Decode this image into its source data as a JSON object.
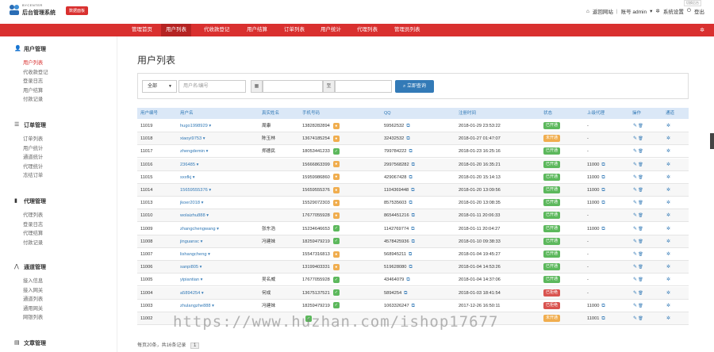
{
  "brand": {
    "small": "BYCENTER",
    "name": "后台管理系统",
    "badge": "数据面板"
  },
  "topbar": {
    "tip": "切换后台",
    "home": "返回网站",
    "account": "账号 admin",
    "settings": "系统设置",
    "logout": "登出"
  },
  "nav": [
    "管理首页",
    "用户列表",
    "代收款登记",
    "用户结算",
    "订单列表",
    "用户统计",
    "代理列表",
    "管理员列表"
  ],
  "sidebar": [
    {
      "title": "用户管理",
      "icon": "user-icon",
      "items": [
        "用户列表",
        "代收款登记",
        "登录日志",
        "用户结算",
        "付款记录"
      ]
    },
    {
      "title": "订单管理",
      "icon": "list-icon",
      "items": [
        "订单列表",
        "用户统计",
        "通道统计",
        "代理统计",
        "冻结订单"
      ]
    },
    {
      "title": "代理管理",
      "icon": "book-icon",
      "items": [
        "代理列表",
        "登录日志",
        "代理结算",
        "付款记录"
      ]
    },
    {
      "title": "通道管理",
      "icon": "road-icon",
      "items": [
        "接入信息",
        "接入网关",
        "通道列表",
        "通用网关",
        "网银列表"
      ]
    },
    {
      "title": "文章管理",
      "icon": "doc-icon",
      "items": []
    }
  ],
  "main": {
    "title": "用户列表",
    "filter": {
      "select_value": "全部",
      "keyword_placeholder": "用户名/编号",
      "date_icon": "▦",
      "date_sep": "至",
      "query_label": "立即查询"
    },
    "columns": [
      "用户编号",
      "用户名",
      "真实姓名",
      "手机号码",
      "QQ",
      "注册时间",
      "状态",
      "上级代理",
      "操作",
      "通道"
    ],
    "rows": [
      {
        "id": "11019",
        "name": "hugo1998929",
        "real": "周康",
        "phone": "13828282894",
        "pi": "orange",
        "qq": "59562532",
        "time": "2018-01-29 23:53:22",
        "status": "已开通",
        "sc": "green",
        "agent": "-"
      },
      {
        "id": "11018",
        "name": "xiaoyi9753",
        "real": "陈玉林",
        "phone": "13674185254",
        "pi": "orange",
        "qq": "32432532",
        "time": "2018-01-27 01:47:07",
        "status": "未开通",
        "sc": "orange",
        "agent": "-"
      },
      {
        "id": "11017",
        "name": "zhengdemin",
        "real": "郑德民",
        "phone": "18053441233",
        "pi": "green",
        "qq": "799784222",
        "time": "2018-01-23 16:25:16",
        "status": "已开通",
        "sc": "green",
        "agent": "-"
      },
      {
        "id": "11016",
        "name": "236485",
        "real": "",
        "phone": "15666863399",
        "pi": "orange",
        "qq": "2997568282",
        "time": "2018-01-20 16:35:21",
        "status": "已开通",
        "sc": "green",
        "agent": "11000"
      },
      {
        "id": "11015",
        "name": "sxxfkj",
        "real": "",
        "phone": "15959986860",
        "pi": "orange",
        "qq": "429067428",
        "time": "2018-01-20 15:14:13",
        "status": "已开通",
        "sc": "green",
        "agent": "11000"
      },
      {
        "id": "11014",
        "name": "15659555376",
        "real": "",
        "phone": "15659555376",
        "pi": "orange",
        "qq": "1104369448",
        "time": "2018-01-20 13:09:56",
        "status": "已开通",
        "sc": "green",
        "agent": "11000"
      },
      {
        "id": "11013",
        "name": "jkoer2018",
        "real": "",
        "phone": "15529072303",
        "pi": "orange",
        "qq": "857535603",
        "time": "2018-01-20 13:08:35",
        "status": "已开通",
        "sc": "green",
        "agent": "11000"
      },
      {
        "id": "11010",
        "name": "wolaizhu888",
        "real": "",
        "phone": "17677055928",
        "pi": "orange",
        "qq": "8654451216",
        "time": "2018-01-11 20:06:33",
        "status": "已开通",
        "sc": "green",
        "agent": "-"
      },
      {
        "id": "11009",
        "name": "zhangchengwang",
        "real": "张东浩",
        "phone": "15234646653",
        "pi": "green",
        "qq": "1142769774",
        "time": "2018-01-11 20:04:27",
        "status": "已开通",
        "sc": "green",
        "agent": "11000"
      },
      {
        "id": "11008",
        "name": "jinguansc",
        "real": "冯建妹",
        "phone": "18259479219",
        "pi": "green",
        "qq": "4578425936",
        "time": "2018-01-10 09:38:33",
        "status": "已开通",
        "sc": "green",
        "agent": "-"
      },
      {
        "id": "11007",
        "name": "lishangcheng",
        "real": "",
        "phone": "15547316813",
        "pi": "orange",
        "qq": "568945211",
        "time": "2018-01-04 19:45:27",
        "status": "已开通",
        "sc": "green",
        "agent": "-"
      },
      {
        "id": "11006",
        "name": "sanpi805",
        "real": "",
        "phone": "13199403331",
        "pi": "orange",
        "qq": "519628080",
        "time": "2018-01-04 14:53:26",
        "status": "已开通",
        "sc": "green",
        "agent": "-"
      },
      {
        "id": "11005",
        "name": "yipiantian",
        "real": "吴名威",
        "phone": "17677055928",
        "pi": "green",
        "qq": "43464079",
        "time": "2018-01-04 14:37:06",
        "status": "已开通",
        "sc": "green",
        "agent": "-"
      },
      {
        "id": "11004",
        "name": "a5894254",
        "real": "何成",
        "phone": "13675137521",
        "pi": "green",
        "qq": "5894254",
        "time": "2018-01-03 18:41:54",
        "status": "已拒绝",
        "sc": "red",
        "agent": "-"
      },
      {
        "id": "11003",
        "name": "zhulangzhe888",
        "real": "冯建妹",
        "phone": "18259479219",
        "pi": "green",
        "qq": "1063326247",
        "time": "2017-12-26 16:50:11",
        "status": "已拒绝",
        "sc": "red",
        "agent": "11000"
      },
      {
        "id": "11002",
        "name": "",
        "real": "",
        "phone": "",
        "pi": "green",
        "qq": "",
        "time": "",
        "status": "未开通",
        "sc": "orange",
        "agent": "11001"
      }
    ],
    "pager_text": "每页20条，共16条记录",
    "pager_page": "1"
  },
  "watermark": "https://www.huzhan.com/ishop17677"
}
